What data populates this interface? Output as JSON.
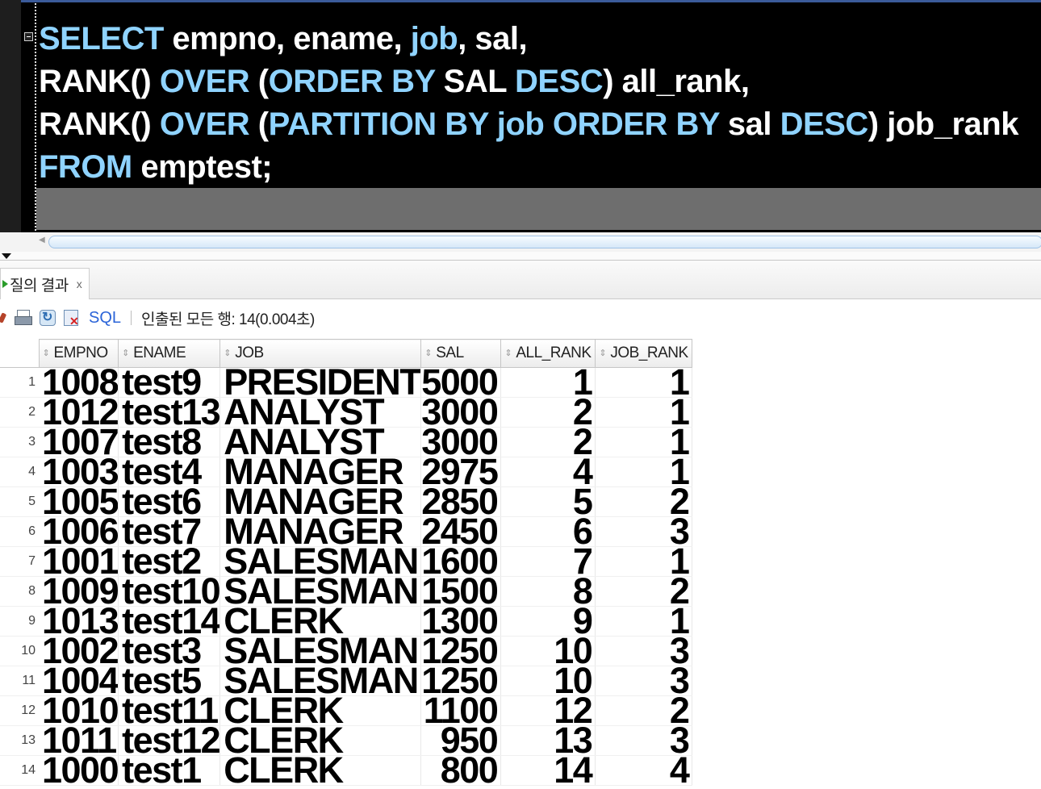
{
  "editor": {
    "lines": [
      [
        {
          "t": "SELECT",
          "k": 1
        },
        {
          "t": " empno, ename, ",
          "k": 0
        },
        {
          "t": "job",
          "k": 1
        },
        {
          "t": ", sal,",
          "k": 0
        }
      ],
      [
        {
          "t": "RANK() ",
          "k": 0
        },
        {
          "t": "OVER",
          "k": 1
        },
        {
          "t": " (",
          "k": 0
        },
        {
          "t": "ORDER BY",
          "k": 1
        },
        {
          "t": " SAL ",
          "k": 0
        },
        {
          "t": "DESC",
          "k": 1
        },
        {
          "t": ") all_rank,",
          "k": 0
        }
      ],
      [
        {
          "t": "RANK() ",
          "k": 0
        },
        {
          "t": "OVER",
          "k": 1
        },
        {
          "t": " (",
          "k": 0
        },
        {
          "t": "PARTITION BY",
          "k": 1
        },
        {
          "t": " ",
          "k": 0
        },
        {
          "t": "job",
          "k": 1
        },
        {
          "t": " ",
          "k": 0
        },
        {
          "t": "ORDER BY",
          "k": 1
        },
        {
          "t": " sal ",
          "k": 0
        },
        {
          "t": "DESC",
          "k": 1
        },
        {
          "t": ") job_rank",
          "k": 0
        }
      ],
      [
        {
          "t": "FROM",
          "k": 1
        },
        {
          "t": " emptest;",
          "k": 0
        }
      ]
    ],
    "colors": {
      "keyword": "#8fd3ff",
      "text": "#ffffff",
      "background": "#000000"
    }
  },
  "results_tab": {
    "label": "질의 결과",
    "close": "x"
  },
  "toolbar": {
    "icons": [
      "pin-icon",
      "print-icon",
      "refresh-icon",
      "export-icon"
    ],
    "sql_label": "SQL",
    "status": "인출된 모든 행: 14(0.004초)"
  },
  "grid": {
    "columns": [
      "EMPNO",
      "ENAME",
      "JOB",
      "SAL",
      "ALL_RANK",
      "JOB_RANK"
    ],
    "rows": [
      [
        "1008",
        "test9",
        "PRESIDENT",
        "5000",
        "1",
        "1"
      ],
      [
        "1012",
        "test13",
        "ANALYST",
        "3000",
        "2",
        "1"
      ],
      [
        "1007",
        "test8",
        "ANALYST",
        "3000",
        "2",
        "1"
      ],
      [
        "1003",
        "test4",
        "MANAGER",
        "2975",
        "4",
        "1"
      ],
      [
        "1005",
        "test6",
        "MANAGER",
        "2850",
        "5",
        "2"
      ],
      [
        "1006",
        "test7",
        "MANAGER",
        "2450",
        "6",
        "3"
      ],
      [
        "1001",
        "test2",
        "SALESMAN",
        "1600",
        "7",
        "1"
      ],
      [
        "1009",
        "test10",
        "SALESMAN",
        "1500",
        "8",
        "2"
      ],
      [
        "1013",
        "test14",
        "CLERK",
        "1300",
        "9",
        "1"
      ],
      [
        "1002",
        "test3",
        "SALESMAN",
        "1250",
        "10",
        "3"
      ],
      [
        "1004",
        "test5",
        "SALESMAN",
        "1250",
        "10",
        "3"
      ],
      [
        "1010",
        "test11",
        "CLERK",
        "1100",
        "12",
        "2"
      ],
      [
        "1011",
        "test12",
        "CLERK",
        "950",
        "13",
        "3"
      ],
      [
        "1000",
        "test1",
        "CLERK",
        "800",
        "14",
        "4"
      ]
    ]
  }
}
